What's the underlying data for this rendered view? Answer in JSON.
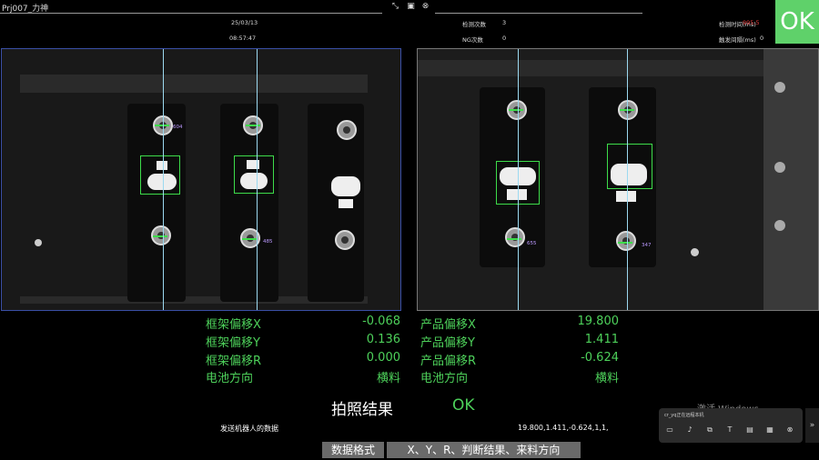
{
  "window": {
    "title": "Prj007_力神"
  },
  "header": {
    "date": "25/03/13",
    "time": "08:57:47",
    "detect_count_label": "检测次数",
    "detect_count": "3",
    "ng_count_label": "NG次数",
    "ng_count": "0",
    "detect_time_label": "检测时间(ms)",
    "detect_time": "995.5",
    "trigger_interval_label": "触发间隔(ms)",
    "trigger_interval": "0",
    "status": "OK"
  },
  "cameras": {
    "left": {
      "readout_top": "604",
      "readout_bottom": "485"
    },
    "right": {
      "readout_left": "655",
      "readout_right": "347"
    }
  },
  "measurements": {
    "frame": [
      {
        "label": "框架偏移X",
        "value": "-0.068"
      },
      {
        "label": "框架偏移Y",
        "value": "0.136"
      },
      {
        "label": "框架偏移R",
        "value": "0.000"
      },
      {
        "label": "电池方向",
        "value": "横料"
      }
    ],
    "product": [
      {
        "label": "产品偏移X",
        "value": "19.800"
      },
      {
        "label": "产品偏移Y",
        "value": "1.411"
      },
      {
        "label": "产品偏移R",
        "value": "-0.624"
      },
      {
        "label": "电池方向",
        "value": "横料"
      }
    ]
  },
  "result": {
    "label": "拍照结果",
    "value": "OK"
  },
  "robot": {
    "send_label": "发送机器人的数据",
    "send_value": "19.800,1.411,-0.624,1,1,"
  },
  "format": {
    "label": "数据格式",
    "value": "X、Y、R、判断结果、来料方向"
  },
  "overlay": {
    "watermark_title": "激活 Windows",
    "watermark_sub": "转到\"设置\"以激活 Windows。",
    "notification_text": "cr_yq正在远程本机"
  },
  "colors": {
    "ok_green": "#5fd16a",
    "measure_green": "#4dd05a",
    "detect_time_red": "#e23c3c"
  }
}
